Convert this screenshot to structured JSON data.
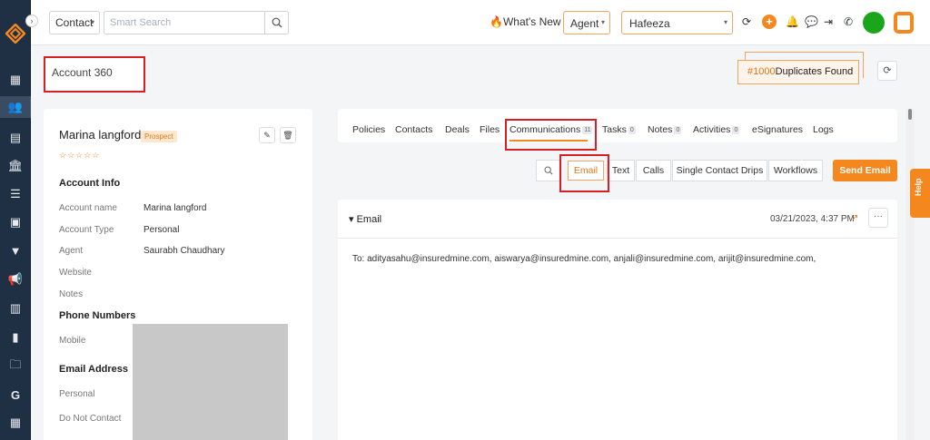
{
  "topbar": {
    "entity_select": "Contact",
    "search_placeholder": "Smart Search",
    "whats_new": "What's New",
    "agent_select": "Agent",
    "user_select": "Hafeeza"
  },
  "header": {
    "title": "Account 360",
    "duplicates_count": "#1000",
    "duplicates_label": "Duplicates Found"
  },
  "profile": {
    "name": "Marina langford",
    "badge": "Prospect",
    "stars": "☆☆☆☆☆",
    "account_info_title": "Account Info",
    "fields": [
      {
        "label": "Account name",
        "value": "Marina langford"
      },
      {
        "label": "Account Type",
        "value": "Personal"
      },
      {
        "label": "Agent",
        "value": "Saurabh Chaudhary"
      },
      {
        "label": "Website",
        "value": ""
      },
      {
        "label": "Notes",
        "value": ""
      }
    ],
    "phone_title": "Phone Numbers",
    "phone_label": "Mobile",
    "email_title": "Email Address",
    "email_personal_label": "Personal",
    "do_not_contact_label": "Do Not Contact"
  },
  "tabs": [
    {
      "label": "Policies",
      "count": ""
    },
    {
      "label": "Contacts",
      "count": ""
    },
    {
      "label": "Deals",
      "count": ""
    },
    {
      "label": "Files",
      "count": ""
    },
    {
      "label": "Communications",
      "count": "11"
    },
    {
      "label": "Tasks",
      "count": "0"
    },
    {
      "label": "Notes",
      "count": "0"
    },
    {
      "label": "Activities",
      "count": "0"
    },
    {
      "label": "eSignatures",
      "count": ""
    },
    {
      "label": "Logs",
      "count": ""
    }
  ],
  "filters": {
    "email": "Email",
    "text": "Text",
    "calls": "Calls",
    "drips": "Single Contact Drips",
    "workflows": "Workflows",
    "send_email": "Send Email"
  },
  "email_item": {
    "title": "Email",
    "date": "03/21/2023, 4:37 PM",
    "to": "To: adityasahu@insuredmine.com,  aiswarya@insuredmine.com,  anjali@insuredmine.com,  arijit@insuredmine.com,"
  },
  "help_label": "Help",
  "colors": {
    "accent": "#f5871f",
    "sidebar": "#1f3044",
    "highlight_box": "#d81f26"
  }
}
